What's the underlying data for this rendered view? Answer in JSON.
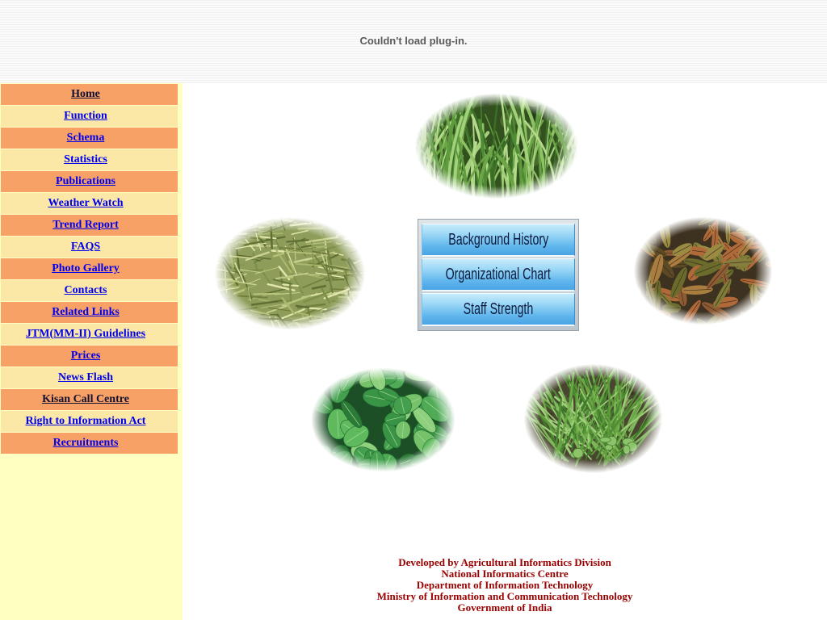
{
  "banner": {
    "plugin_message": "Couldn't load plug-in."
  },
  "colors": {
    "menu_row_orange": "#f8a166",
    "menu_row_yellow": "#fbe8a6",
    "sidebar_background": "#ffffc2",
    "link": "#0000ee",
    "link_visited": "#111133",
    "footer_text": "#990000",
    "panel_button_text": "#0c1a3e"
  },
  "sidebar": {
    "items": [
      {
        "label": "Home",
        "visited": true
      },
      {
        "label": "Function",
        "visited": false
      },
      {
        "label": "Schema",
        "visited": false
      },
      {
        "label": "Statistics",
        "visited": false
      },
      {
        "label": "Publications",
        "visited": false
      },
      {
        "label": "Weather Watch",
        "visited": false
      },
      {
        "label": "Trend Report",
        "visited": false
      },
      {
        "label": "FAQS",
        "visited": false
      },
      {
        "label": "Photo Gallery",
        "visited": false
      },
      {
        "label": "Contacts",
        "visited": false
      },
      {
        "label": "Related Links",
        "visited": false
      },
      {
        "label": "JTM(MM-II) Guidelines",
        "visited": false
      },
      {
        "label": "Prices",
        "visited": false
      },
      {
        "label": "News Flash",
        "visited": false
      },
      {
        "label": "Kisan Call Centre",
        "visited": true
      },
      {
        "label": "Right to Information Act",
        "visited": false
      },
      {
        "label": "Recruitments",
        "visited": false
      }
    ]
  },
  "main": {
    "info_panel": {
      "buttons": [
        "Background History",
        "Organizational Chart",
        "Staff Strength"
      ]
    }
  },
  "footer": {
    "lines": [
      "Developed by Agricultural Informatics Division",
      "National Informatics Centre",
      "Department of Information Technology",
      "Ministry of Information and Communication Technology",
      "Government of India"
    ]
  }
}
